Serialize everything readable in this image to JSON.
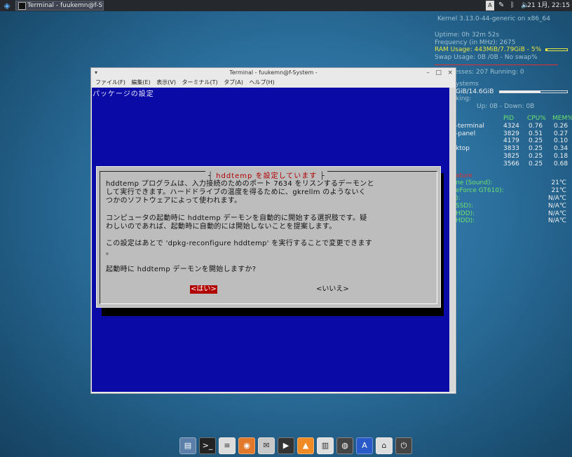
{
  "topbar": {
    "task_title": "Terminal - fuukemn@f-Sys...",
    "clock": "21 1月, 22:15",
    "tray_icons": [
      "ime-icon",
      "pen-icon",
      "bluetooth-icon",
      "volume-icon"
    ]
  },
  "conky": {
    "kernel": "Kernel 3.13.0-44-generic on x86_64",
    "uptime": "Uptime: 0h 32m 52s",
    "frequency": "Frequency (in MHz): 2675",
    "ram": "RAM Usage: 443MiB/7.79GiB - 5%",
    "swap": "Swap Usage: 0B /0B  - No swap%",
    "processes": "esses: 207  Running: 0",
    "fs_title": "ystems",
    "fs_usage": "GiB/14.6GiB",
    "net_title": "king:",
    "net_speeds": "Up: 0B    - Down: 0B",
    "proc_header": {
      "pid": "PID",
      "cpu": "CPU%",
      "mem": "MEM%"
    },
    "procs": [
      {
        "name": "-terminal",
        "pid": "4324",
        "cpu": "0.76",
        "mem": "0.26"
      },
      {
        "name": "-panel",
        "pid": "3829",
        "cpu": "0.51",
        "mem": "0.27"
      },
      {
        "name": "",
        "pid": "4179",
        "cpu": "0.25",
        "mem": "0.10"
      },
      {
        "name": "ktop",
        "pid": "3833",
        "cpu": "0.25",
        "mem": "0.34"
      },
      {
        "name": "",
        "pid": "3825",
        "cpu": "0.25",
        "mem": "0.18"
      },
      {
        "name": "",
        "pid": "3566",
        "cpu": "0.25",
        "mem": "0.68"
      }
    ],
    "temps_title": "ature",
    "temps": [
      {
        "name": "ne (Sound):",
        "value": "21℃"
      },
      {
        "name": "eForce GT610):",
        "value": "21℃"
      },
      {
        "name": "):",
        "value": "N/A℃"
      },
      {
        "name": "SSD):",
        "value": "N/A℃"
      },
      {
        "name": "HDD):",
        "value": "N/A℃"
      },
      {
        "name": "HDD):",
        "value": "N/A℃"
      }
    ],
    "ram_fraction": 0.05,
    "fs_fraction": 0.6
  },
  "window": {
    "title": "Terminal - fuukemn@f-System -",
    "menus": [
      "ファイル(F)",
      "編集(E)",
      "表示(V)",
      "ターミナル(T)",
      "タブ(A)",
      "ヘルプ(H)"
    ]
  },
  "terminal": {
    "header": "パッケージの設定",
    "dialog_title": "hddtemp を設定しています",
    "dialog_body": "hddtemp プログラムは、入力接続のためのポート 7634 をリスンするデーモンと\nして実行できます。ハードドライブの温度を得るために、gkrellm のようないく\nつかのソフトウェアによって使われます。\n\nコンピュータの起動時に hddtemp デーモンを自動的に開始する選択肢です。疑\nわしいのであれば、起動時に自動的には開始しないことを提案します。\n\nこの設定はあとで 'dpkg-reconfigure hddtemp' を実行することで変更できます\n。\n\n起動時に hddtemp デーモンを開始しますか?",
    "yes": "<はい>",
    "no": "<いいえ>"
  },
  "dock": {
    "items": [
      "file-manager-icon",
      "terminal-icon",
      "text-editor-icon",
      "firefox-icon",
      "email-icon",
      "video-player-icon",
      "vlc-icon",
      "audio-mixer-icon",
      "disk-utility-icon",
      "font-viewer-icon",
      "trash-icon",
      "logout-icon"
    ]
  }
}
